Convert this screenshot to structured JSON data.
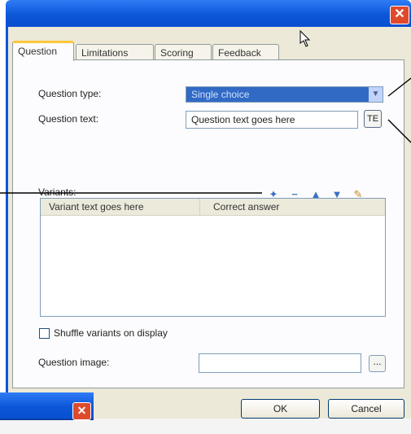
{
  "window": {
    "close_icon": "close-icon",
    "tabs": [
      {
        "label": "Question",
        "active": true
      },
      {
        "label": "Limitations",
        "active": false
      },
      {
        "label": "Scoring",
        "active": false
      },
      {
        "label": "Feedback",
        "active": false
      }
    ]
  },
  "form": {
    "question_type_label": "Question type:",
    "question_type_value": "Single choice",
    "question_text_label": "Question text:",
    "question_text_value": "Question text goes here",
    "te_button": "TE",
    "variants_label": "Variants:",
    "toolbar_icons": [
      "add-icon",
      "remove-icon",
      "move-up-icon",
      "move-down-icon",
      "edit-icon"
    ],
    "grid_columns": [
      "Variant text goes here",
      "Correct answer"
    ],
    "shuffle_label": "Shuffle variants on display",
    "shuffle_checked": false,
    "question_image_label": "Question image:",
    "question_image_value": "",
    "browse_button": "..."
  },
  "buttons": {
    "ok": "OK",
    "cancel": "Cancel"
  },
  "colors": {
    "title_blue": "#0b56d8",
    "selection_blue": "#316ac5",
    "close_red": "#e04a2c",
    "dialog_bg": "#ece9d8"
  }
}
